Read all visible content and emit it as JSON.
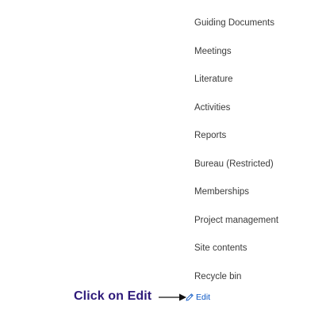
{
  "nav": {
    "items": [
      {
        "label": "Guiding Documents"
      },
      {
        "label": "Meetings"
      },
      {
        "label": "Literature"
      },
      {
        "label": "Activities"
      },
      {
        "label": "Reports"
      },
      {
        "label": "Bureau (Restricted)"
      },
      {
        "label": "Memberships"
      },
      {
        "label": "Project management"
      },
      {
        "label": "Site contents"
      },
      {
        "label": "Recycle bin"
      }
    ],
    "edit_label": "Edit"
  },
  "annotation": {
    "text": "Click on Edit",
    "color": "#2e1a7a"
  },
  "colors": {
    "link": "#0b57c5",
    "nav_text": "#3b3b3b"
  },
  "icons": {
    "edit": "pencil-icon",
    "pointer": "arrow-right-icon"
  }
}
